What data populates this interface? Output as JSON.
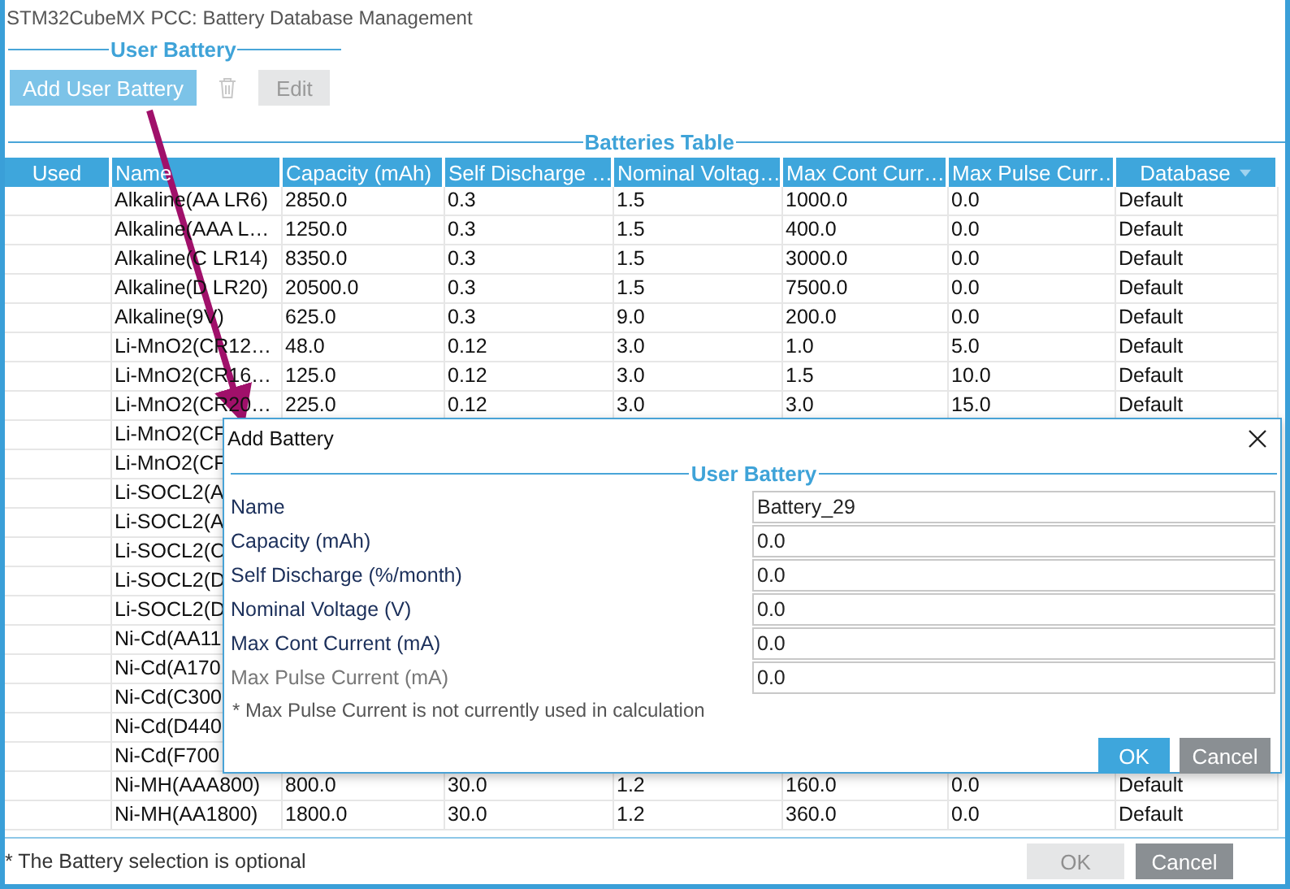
{
  "window": {
    "title": "STM32CubeMX PCC: Battery Database Management"
  },
  "user_battery": {
    "legend": "User Battery",
    "buttons": [
      {
        "kind": "text",
        "label": "Add User Battery",
        "disabled": false
      },
      {
        "kind": "trash",
        "disabled": true
      },
      {
        "kind": "text",
        "label": "Edit",
        "disabled": true
      }
    ]
  },
  "table": {
    "legend": "Batteries Table",
    "columns": [
      {
        "label": "Used"
      },
      {
        "label": "Name"
      },
      {
        "label": "Capacity (mAh)"
      },
      {
        "label": "Self Discharge …"
      },
      {
        "label": "Nominal Voltag…"
      },
      {
        "label": "Max Cont Curr…"
      },
      {
        "label": "Max Pulse Curr…"
      },
      {
        "label": "Database",
        "sorted": true
      }
    ],
    "rows": [
      {
        "cells": [
          "",
          "Alkaline(AA LR6)",
          "2850.0",
          "0.3",
          "1.5",
          "1000.0",
          "0.0",
          "Default"
        ]
      },
      {
        "cells": [
          "",
          "Alkaline(AAA L…",
          "1250.0",
          "0.3",
          "1.5",
          "400.0",
          "0.0",
          "Default"
        ]
      },
      {
        "cells": [
          "",
          "Alkaline(C LR14)",
          "8350.0",
          "0.3",
          "1.5",
          "3000.0",
          "0.0",
          "Default"
        ]
      },
      {
        "cells": [
          "",
          "Alkaline(D LR20)",
          "20500.0",
          "0.3",
          "1.5",
          "7500.0",
          "0.0",
          "Default"
        ]
      },
      {
        "cells": [
          "",
          "Alkaline(9V)",
          "625.0",
          "0.3",
          "9.0",
          "200.0",
          "0.0",
          "Default"
        ]
      },
      {
        "cells": [
          "",
          "Li-MnO2(CR12…",
          "48.0",
          "0.12",
          "3.0",
          "1.0",
          "5.0",
          "Default"
        ]
      },
      {
        "cells": [
          "",
          "Li-MnO2(CR16…",
          "125.0",
          "0.12",
          "3.0",
          "1.5",
          "10.0",
          "Default"
        ]
      },
      {
        "cells": [
          "",
          "Li-MnO2(CR20…",
          "225.0",
          "0.12",
          "3.0",
          "3.0",
          "15.0",
          "Default"
        ]
      },
      {
        "cells": [
          "",
          "Li-MnO2(CF"
        ]
      },
      {
        "cells": [
          "",
          "Li-MnO2(CF"
        ]
      },
      {
        "cells": [
          "",
          "Li-SOCL2(A"
        ]
      },
      {
        "cells": [
          "",
          "Li-SOCL2(A"
        ]
      },
      {
        "cells": [
          "",
          "Li-SOCL2(C"
        ]
      },
      {
        "cells": [
          "",
          "Li-SOCL2(D"
        ]
      },
      {
        "cells": [
          "",
          "Li-SOCL2(D"
        ]
      },
      {
        "cells": [
          "",
          "Ni-Cd(AA11"
        ]
      },
      {
        "cells": [
          "",
          "Ni-Cd(A170"
        ]
      },
      {
        "cells": [
          "",
          "Ni-Cd(C300"
        ]
      },
      {
        "cells": [
          "",
          "Ni-Cd(D440"
        ]
      },
      {
        "cells": [
          "",
          "Ni-Cd(F700"
        ]
      },
      {
        "cells": [
          "",
          "Ni-MH(AAA800)",
          "800.0",
          "30.0",
          "1.2",
          "160.0",
          "0.0",
          "Default"
        ]
      },
      {
        "cells": [
          "",
          "Ni-MH(AA1800)",
          "1800.0",
          "30.0",
          "1.2",
          "360.0",
          "0.0",
          "Default"
        ]
      }
    ]
  },
  "footer": {
    "note": "* The Battery selection is optional",
    "buttons": [
      {
        "label": "OK",
        "disabled": true
      },
      {
        "label": "Cancel",
        "disabled": false
      }
    ]
  },
  "dialog": {
    "title": "Add Battery",
    "legend": "User Battery",
    "fields": [
      {
        "label": "Name",
        "value": "Battery_29",
        "disabled": false
      },
      {
        "label": "Capacity (mAh)",
        "value": "0.0",
        "disabled": false
      },
      {
        "label": "Self Discharge (%/month)",
        "value": "0.0",
        "disabled": false
      },
      {
        "label": "Nominal Voltage (V)",
        "value": "0.0",
        "disabled": false
      },
      {
        "label": "Max Cont Current (mA)",
        "value": "0.0",
        "disabled": false
      },
      {
        "label": "Max Pulse Current (mA)",
        "value": "0.0",
        "disabled": true
      }
    ],
    "note": "* Max Pulse Current is not currently used in calculation",
    "buttons": [
      {
        "label": "OK",
        "kind": "primary"
      },
      {
        "label": "Cancel",
        "kind": "secondary"
      }
    ]
  }
}
